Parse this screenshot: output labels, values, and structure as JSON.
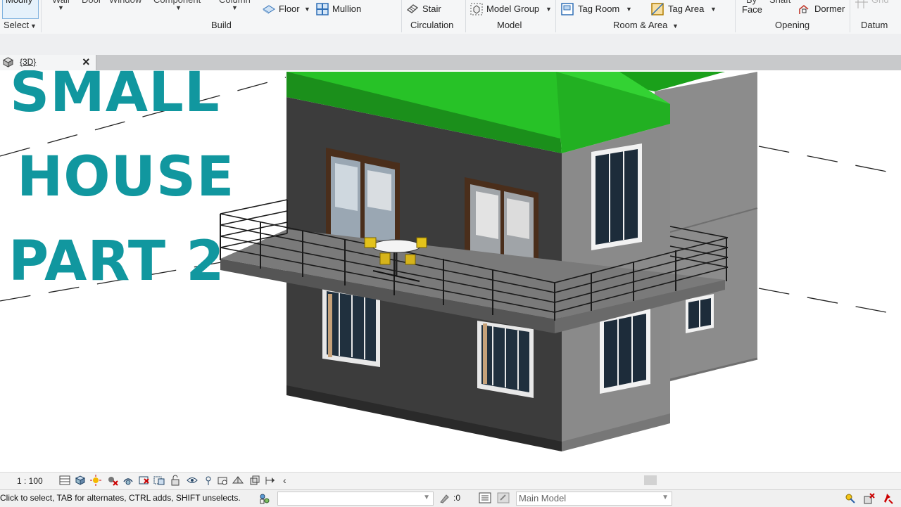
{
  "ribbon": {
    "select": {
      "top_label": "Modify",
      "panel": "Select"
    },
    "build": {
      "cut_labels": [
        "Wall",
        "Door",
        "Window",
        "Component",
        "Column"
      ],
      "floor": "Floor",
      "mullion": "Mullion",
      "panel": "Build"
    },
    "circulation": {
      "stair": "Stair",
      "panel": "Circulation"
    },
    "model": {
      "model_group": "Model  Group",
      "panel": "Model"
    },
    "room_area": {
      "tag_room": "Tag  Room",
      "tag_area": "Tag  Area",
      "panel": "Room & Area"
    },
    "opening": {
      "by": "By",
      "face": "Face",
      "shaft": "Shaft",
      "dormer": "Dormer",
      "panel": "Opening"
    },
    "datum": {
      "grid": "Grid",
      "panel": "Datum"
    }
  },
  "view_tab": {
    "label": "{3D}",
    "close": "×"
  },
  "thumbnail_title": {
    "line1": "SMALL",
    "line2": "HOUSE",
    "line3": "PART 2"
  },
  "view_control": {
    "scale": "1 : 100"
  },
  "status_bar": {
    "message": "Click to select, TAB for alternates, CTRL adds, SHIFT unselects.",
    "selection_count": ":0",
    "model": "Main Model"
  },
  "colors": {
    "title": "#11979f",
    "roof": "#1fb51f",
    "wall_dark": "#3d3d3d",
    "wall_light": "#8a8a8a"
  }
}
